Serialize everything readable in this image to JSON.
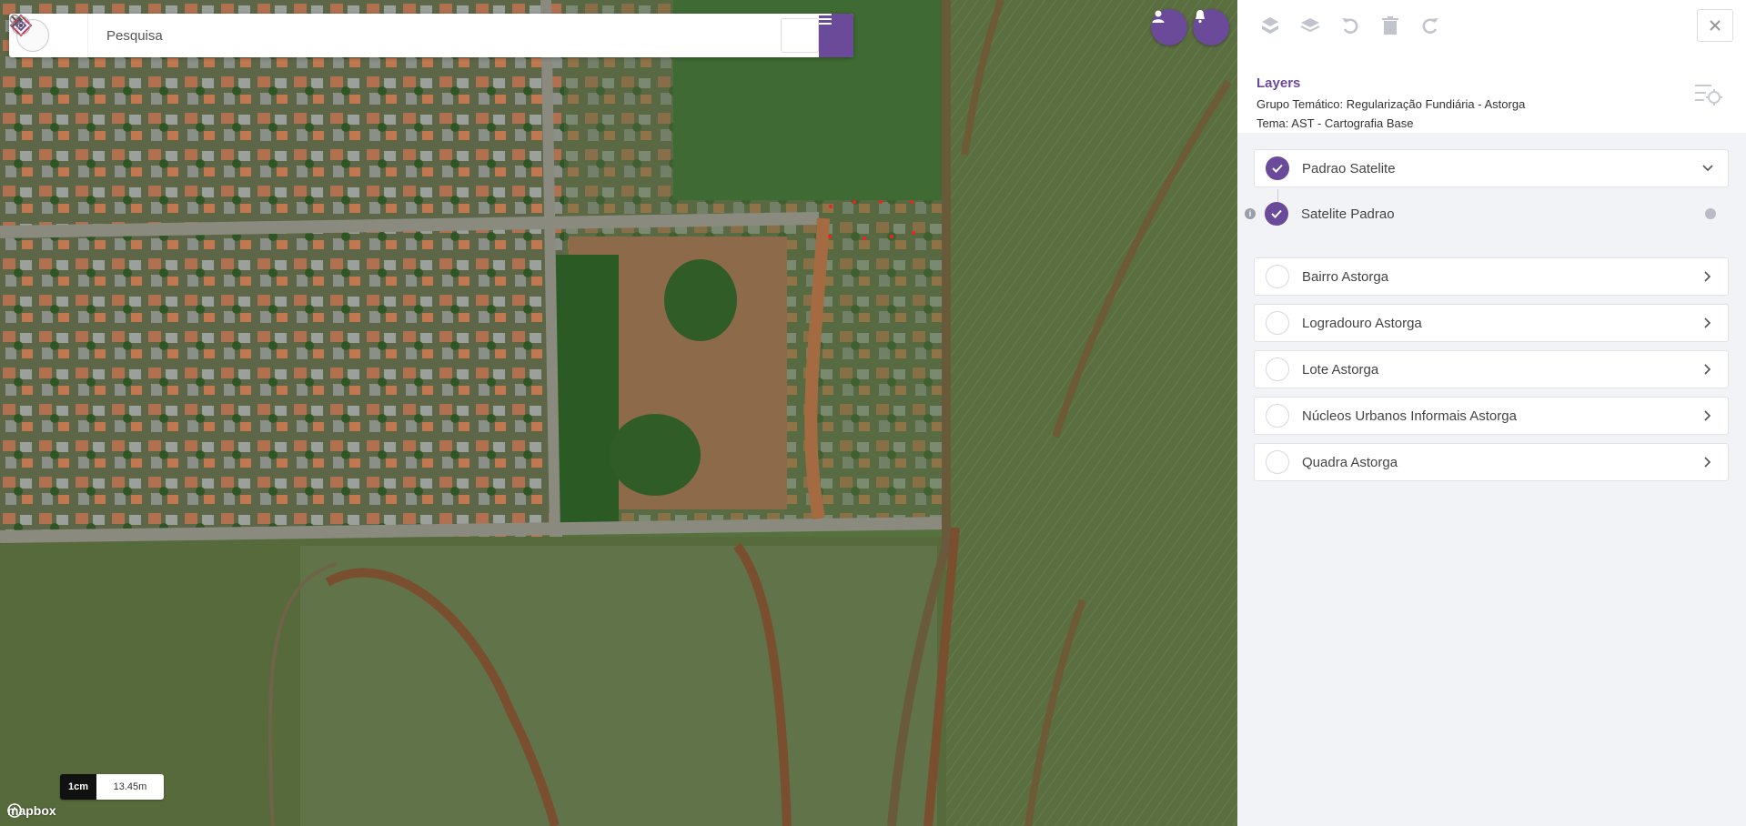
{
  "search": {
    "placeholder": "Pesquisa"
  },
  "map": {
    "scale_unit": "1cm",
    "scale_value": "13.45m",
    "attribution": "mapbox"
  },
  "panel": {
    "title": "Layers",
    "group_line": "Grupo Temático: Regularização Fundiária - Astorga",
    "theme_line": "Tema: AST - Cartografia Base",
    "layers": [
      {
        "label": "Padrao Satelite",
        "checked": true,
        "expanded": true
      },
      {
        "label": "Bairro Astorga",
        "checked": false
      },
      {
        "label": "Logradouro Astorga",
        "checked": false
      },
      {
        "label": "Lote Astorga",
        "checked": false
      },
      {
        "label": "Núcleos Urbanos Informais Astorga",
        "checked": false
      },
      {
        "label": "Quadra Astorga",
        "checked": false
      }
    ],
    "sublayer": {
      "label": "Satelite Padrao",
      "checked": true
    }
  },
  "colors": {
    "accent": "#6b4a9a",
    "panel_bg": "#f2f3f6"
  },
  "icons": [
    "search-icon",
    "tools-icon",
    "menu-icon",
    "user-icon",
    "bell-icon",
    "layers-add-icon",
    "layers-icon",
    "undo-icon",
    "trash-icon",
    "redo-icon",
    "close-icon",
    "layer-settings-icon",
    "info-icon",
    "chevron-down-icon",
    "chevron-right-icon",
    "check-icon"
  ]
}
